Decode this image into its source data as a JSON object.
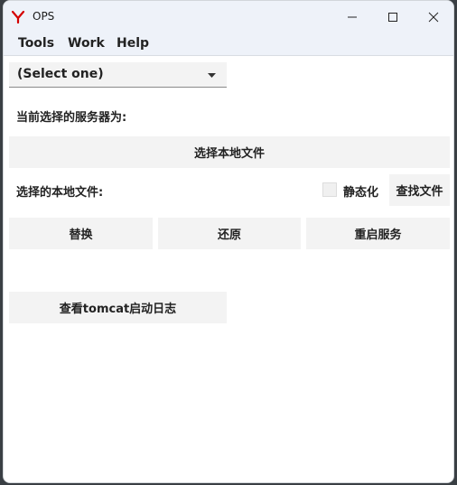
{
  "window": {
    "title": "OPS",
    "accent": "#d40000",
    "titlebar_bg": "#eef2f9",
    "controls": [
      "minimize-icon",
      "maximize-icon",
      "close-icon"
    ]
  },
  "menu": {
    "items": [
      "Tools",
      "Work",
      "Help"
    ]
  },
  "server_select": {
    "value": "(Select one)"
  },
  "labels": {
    "current_server": "当前选择的服务器为:",
    "local_file": "选择的本地文件:"
  },
  "buttons": {
    "choose_local_file": "选择本地文件",
    "find_file": "查找文件",
    "replace": "替换",
    "restore": "还原",
    "restart_service": "重启服务",
    "view_tomcat_log": "查看tomcat启动日志"
  },
  "static_checkbox": {
    "label": "静态化",
    "checked": false
  }
}
